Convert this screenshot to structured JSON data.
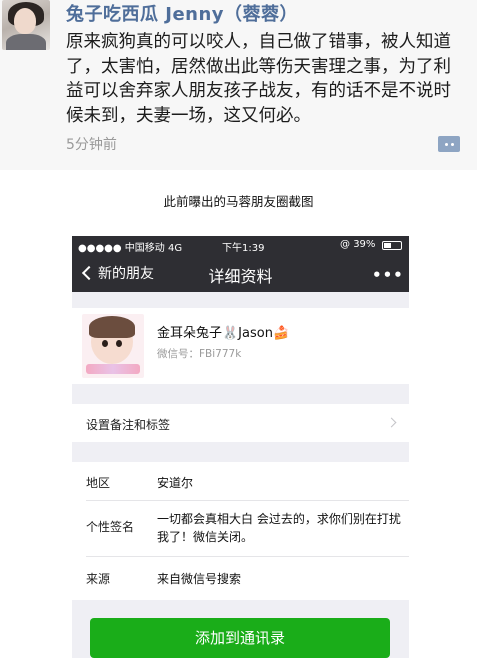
{
  "post": {
    "author": "兔子吃西瓜 Jenny（蓉蓉）",
    "text": "原来疯狗真的可以咬人，自己做了错事，被人知道了，太害怕，居然做出此等伤天害理之事，为了利益可以舍弃家人朋友孩子战友，有的话不是不说时候未到，夫妻一场，这又何必。",
    "time": "5分钟前",
    "icons": {
      "avatar": "user-avatar",
      "comment": "comment-icon"
    }
  },
  "caption": "此前曝出的马蓉朋友圈截图",
  "phone": {
    "status_bar": {
      "carrier": "●●●●● 中国移动  4G",
      "time": "下午1:39",
      "battery": "39%",
      "orientation_lock": "@"
    },
    "nav": {
      "back_label": "新的朋友",
      "title": "详细资料",
      "more": "•••"
    },
    "profile": {
      "name": "金耳朵兔子🐰Jason🍰",
      "wechat_id": "微信号：FBi777k"
    },
    "rows": {
      "remark": "设置备注和标签",
      "region_label": "地区",
      "region_value": "安道尔",
      "signature_label": "个性签名",
      "signature_value": "一切都会真相大白 会过去的，求你们别在打扰我了！微信关闭。",
      "source_label": "来源",
      "source_value": "来自微信号搜索"
    },
    "add_button": "添加到通讯录",
    "colors": {
      "primary_green": "#1aad19",
      "nav_bg": "#2e2e33",
      "page_bg": "#efeff4"
    }
  }
}
